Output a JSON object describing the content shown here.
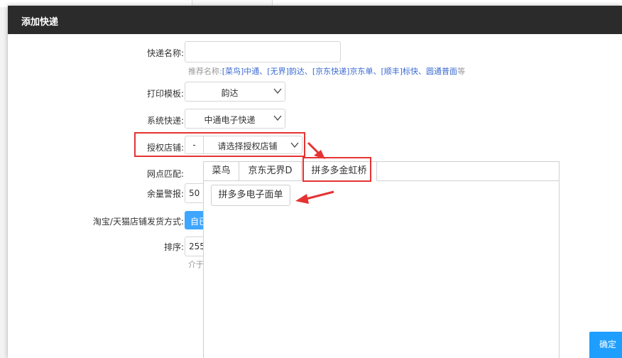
{
  "dialog": {
    "title": "添加快递",
    "confirm_label": "确定"
  },
  "form": {
    "name_label": "快递名称:",
    "name_value": "",
    "name_hint_prefix": "推荐名称:",
    "name_hint_links": "[菜鸟]中通、[无界]韵达、[京东快递]京东单、[顺丰]标快、圆通普面",
    "name_hint_suffix": "等",
    "template_label": "打印模板:",
    "template_value": "韵达",
    "system_label": "系统快递:",
    "system_value": "中通电子快递",
    "shop_label": "授权店铺:",
    "shop_prefix": "-",
    "shop_value": "请选择授权店铺",
    "outlet_label": "网点匹配:",
    "stock_label": "余量警报:",
    "stock_value": "50",
    "taobao_label": "淘宝/天猫店铺发货方式:",
    "taobao_value": "自已",
    "sort_label": "排序:",
    "sort_value": "255",
    "sort_hint": "介于"
  },
  "popup": {
    "tabs": [
      {
        "label": "菜鸟"
      },
      {
        "label": "京东无界D"
      },
      {
        "label": "拼多多金虹桥"
      }
    ],
    "active_tab": 2,
    "item_label": "拼多多电子面单"
  },
  "colors": {
    "highlight": "#e53333",
    "primary": "#1e9fff",
    "titlebar": "#2b2b2b"
  }
}
